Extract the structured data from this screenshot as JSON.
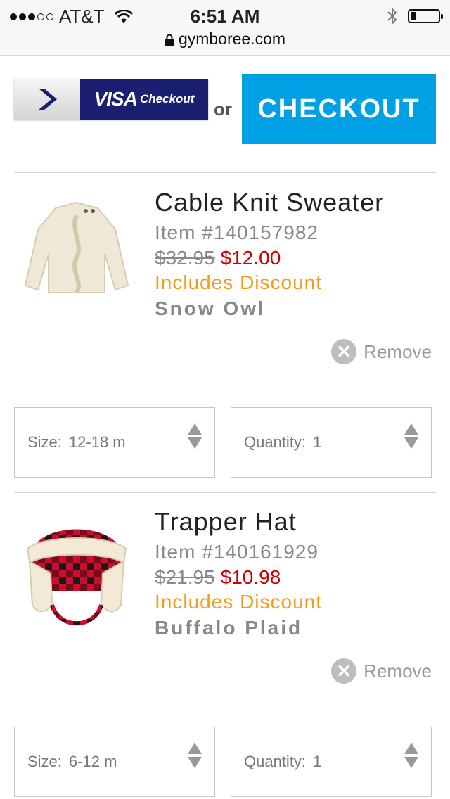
{
  "status_bar": {
    "carrier": "AT&T",
    "time": "6:51 AM",
    "url": "gymboree.com",
    "signal_bars_filled": 3,
    "signal_bars_total": 5,
    "battery_level": 0.2
  },
  "checkout": {
    "visa_label": "VISA",
    "visa_sub": "Checkout",
    "or_label": "or",
    "checkout_label": "CHECKOUT"
  },
  "items": [
    {
      "name": "Cable Knit Sweater",
      "item_no": "Item #140157982",
      "old_price": "$32.95",
      "new_price": "$12.00",
      "discount": "Includes Discount",
      "color": "Snow Owl",
      "remove_label": "Remove",
      "size_label": "Size:",
      "size_value": "12-18  m",
      "qty_label": "Quantity:",
      "qty_value": "1"
    },
    {
      "name": "Trapper Hat",
      "item_no": "Item #140161929",
      "old_price": "$21.95",
      "new_price": "$10.98",
      "discount": "Includes Discount",
      "color": "Buffalo Plaid",
      "remove_label": "Remove",
      "size_label": "Size:",
      "size_value": "6-12  m",
      "qty_label": "Quantity:",
      "qty_value": "1"
    }
  ],
  "colors": {
    "checkout_blue": "#00a0e4",
    "visa_navy": "#1a1f71",
    "sale_red": "#cc0000",
    "discount_orange": "#f49b1c"
  },
  "icons": [
    "wifi-icon",
    "lock-icon",
    "bluetooth-icon",
    "battery-icon",
    "visa-arrow-icon",
    "remove-x-icon",
    "stepper-arrows-icon"
  ]
}
